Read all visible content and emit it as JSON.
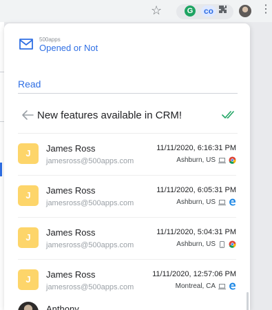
{
  "app": {
    "brand_small": "500apps",
    "brand_name": "Opened or Not"
  },
  "colors": {
    "accent": "#2f6fe4",
    "avatar_bg": "#fdd56a",
    "check_green": "#1fa463"
  },
  "toolbar": {
    "icons": [
      "star-icon",
      "grammarly-icon",
      "co-icon",
      "puzzle-icon",
      "profile-avatar",
      "kebab-menu-icon"
    ],
    "grammarly_letter": "G",
    "co_label": "co"
  },
  "tabs": {
    "read_label": "Read"
  },
  "email": {
    "subject": "New features available in CRM!"
  },
  "recipients": [
    {
      "initial": "J",
      "name": "James Ross",
      "email": "jamesross@500apps.com",
      "time": "11/11/2020, 6:16:31 PM",
      "location": "Ashburn, US",
      "device": "laptop-icon",
      "browser": "chrome-icon"
    },
    {
      "initial": "J",
      "name": "James Ross",
      "email": "jamesross@500apps.com",
      "time": "11/11/2020, 6:05:31 PM",
      "location": "Ashburn, US",
      "device": "laptop-icon",
      "browser": "edge-icon"
    },
    {
      "initial": "J",
      "name": "James Ross",
      "email": "jamesross@500apps.com",
      "time": "11/11/2020, 5:04:31 PM",
      "location": "Ashburn, US",
      "device": "phone-icon",
      "browser": "chrome-icon"
    },
    {
      "initial": "J",
      "name": "James Ross",
      "email": "jamesross@500apps.com",
      "time": "11/11/2020, 12:57:06 PM",
      "location": "Montreal, CA",
      "device": "laptop-icon",
      "browser": "edge-icon"
    }
  ],
  "partial_recipient": {
    "name": "Anthony"
  }
}
